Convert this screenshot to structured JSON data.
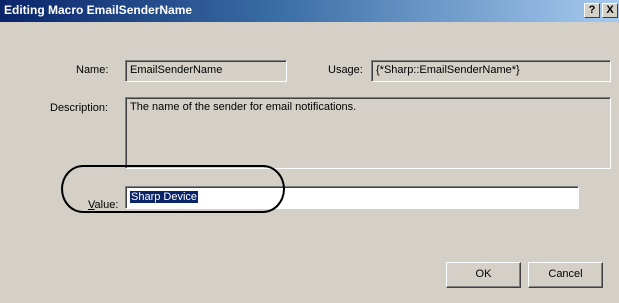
{
  "window": {
    "title": "Editing Macro EmailSenderName",
    "help_button": "?",
    "close_button": "X"
  },
  "form": {
    "name_label": "Name:",
    "name_value": "EmailSenderName",
    "usage_label": "Usage:",
    "usage_value": "{*Sharp::EmailSenderName*}",
    "description_label": "Description:",
    "description_value": "The name of the sender for email notifications.",
    "value_label_accel": "V",
    "value_label_rest": "alue:",
    "value_value": "Sharp Device"
  },
  "buttons": {
    "ok_label": "OK",
    "cancel_label": "Cancel"
  }
}
